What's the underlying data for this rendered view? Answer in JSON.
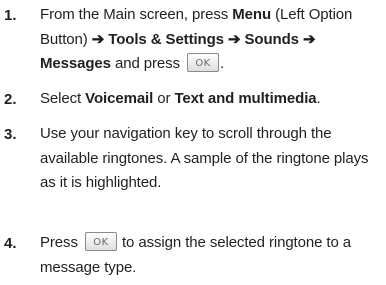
{
  "steps": [
    {
      "number": "1.",
      "p1": "From the Main screen, press ",
      "menu": "Menu",
      "p2": " (Left Option Button) ",
      "arrow": "➔",
      "tools": "Tools & Settings",
      "sounds": "Sounds",
      "messages": "Messages",
      "p3": " and press ",
      "ok": "OK",
      "p4": "."
    },
    {
      "number": "2.",
      "p1": "Select ",
      "voicemail": "Voicemail",
      "p2": " or ",
      "text_mm": "Text and multimedia",
      "p3": "."
    },
    {
      "number": "3.",
      "text": "Use your navigation key to scroll through the available ringtones. A sample of the ringtone plays as it is highlighted."
    },
    {
      "number": "4.",
      "p1": "Press ",
      "ok": "OK",
      "p2": " to assign the selected ringtone to a message type."
    }
  ]
}
